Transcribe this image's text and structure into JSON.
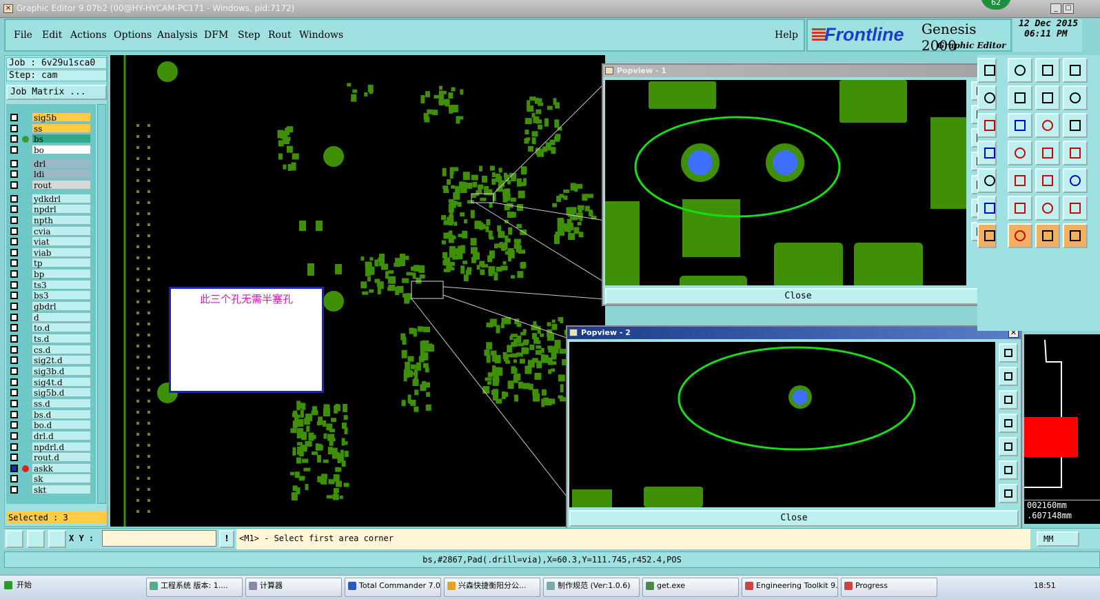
{
  "titlebar": {
    "title": "Graphic Editor 9.07b2 (00@HY-HYCAM-PC171 - Windows, pid:7172)",
    "badge": "62",
    "min": "_",
    "max": "☐"
  },
  "menu": [
    "File",
    "Edit",
    "Actions",
    "Options",
    "Analysis",
    "DFM",
    "Step",
    "Rout",
    "Windows"
  ],
  "help": "Help",
  "brand": {
    "logo": "Frontline",
    "product": "Genesis 2000",
    "subtitle": "Graphic Editor"
  },
  "date": {
    "line1": "12 Dec 2015",
    "line2": "06:11 PM"
  },
  "job": {
    "job_label": "Job : 6v29u1sca0",
    "step_label": "Step: cam",
    "job_matrix": "Job Matrix ..."
  },
  "layers": [
    {
      "name": "sig5b",
      "color": "#ffcc44"
    },
    {
      "name": "ss",
      "color": "#ffcc44"
    },
    {
      "name": "bs",
      "color": "#2fa88a",
      "dot": true
    },
    {
      "name": "bo",
      "color": "#ffffff"
    },
    {
      "name": "drl",
      "color": "#9ab8c8"
    },
    {
      "name": "ldi",
      "color": "#9ab8c8"
    },
    {
      "name": "rout",
      "color": "#d8d8d8"
    },
    {
      "name": "ydkdrl",
      "color": "#bff0f0"
    },
    {
      "name": "npdrl",
      "color": "#bff0f0"
    },
    {
      "name": "npth",
      "color": "#bff0f0"
    },
    {
      "name": "cvia",
      "color": "#bff0f0"
    },
    {
      "name": "viat",
      "color": "#bff0f0"
    },
    {
      "name": "viab",
      "color": "#bff0f0"
    },
    {
      "name": "tp",
      "color": "#bff0f0"
    },
    {
      "name": "bp",
      "color": "#bff0f0"
    },
    {
      "name": "ts3",
      "color": "#bff0f0"
    },
    {
      "name": "bs3",
      "color": "#bff0f0"
    },
    {
      "name": "gbdrl",
      "color": "#bff0f0"
    },
    {
      "name": "d",
      "color": "#bff0f0"
    },
    {
      "name": "to.d",
      "color": "#bff0f0"
    },
    {
      "name": "ts.d",
      "color": "#bff0f0"
    },
    {
      "name": "cs.d",
      "color": "#bff0f0"
    },
    {
      "name": "sig2t.d",
      "color": "#bff0f0"
    },
    {
      "name": "sig3b.d",
      "color": "#bff0f0"
    },
    {
      "name": "sig4t.d",
      "color": "#bff0f0"
    },
    {
      "name": "sig5b.d",
      "color": "#bff0f0"
    },
    {
      "name": "ss.d",
      "color": "#bff0f0"
    },
    {
      "name": "bs.d",
      "color": "#bff0f0"
    },
    {
      "name": "bo.d",
      "color": "#bff0f0"
    },
    {
      "name": "drl.d",
      "color": "#bff0f0"
    },
    {
      "name": "npdrl.d",
      "color": "#bff0f0"
    },
    {
      "name": "rout.d",
      "color": "#bff0f0"
    },
    {
      "name": "askk",
      "color": "#bff0f0",
      "selected": true
    },
    {
      "name": "sk",
      "color": "#bff0f0"
    },
    {
      "name": "skt",
      "color": "#bff0f0"
    }
  ],
  "selected_label": "Selected : 3",
  "annotation": "此三个孔无需半塞孔",
  "popview1": {
    "title": "Popview - 1",
    "close": "Close"
  },
  "popview2": {
    "title": "Popview - 2",
    "close": "Close"
  },
  "coords": {
    "x": "002160mm",
    "y": ".607148mm"
  },
  "cmd": {
    "xy_label": "X Y :",
    "xy_value": "",
    "message": "<M1> - Select first area corner",
    "unit": "MM"
  },
  "status": "bs,#2867,Pad(.drill=via),X=60.3,Y=111.745,r452.4,POS",
  "taskbar": {
    "start": "开始",
    "tasks": [
      "工程系统  版本: 1....",
      "计算器",
      "Total Commander 7.0....",
      "兴森快捷衡阳分公...",
      "制作规范 (Ver:1.0.6)",
      "get.exe",
      "Engineering Toolkit 9....",
      "Progress"
    ],
    "time": "18:51"
  },
  "colors": {
    "pad_green": "#3f8f07",
    "drill_blue": "#3f6fff",
    "highlight": "#15e015",
    "accent_red": "#ff0000"
  }
}
